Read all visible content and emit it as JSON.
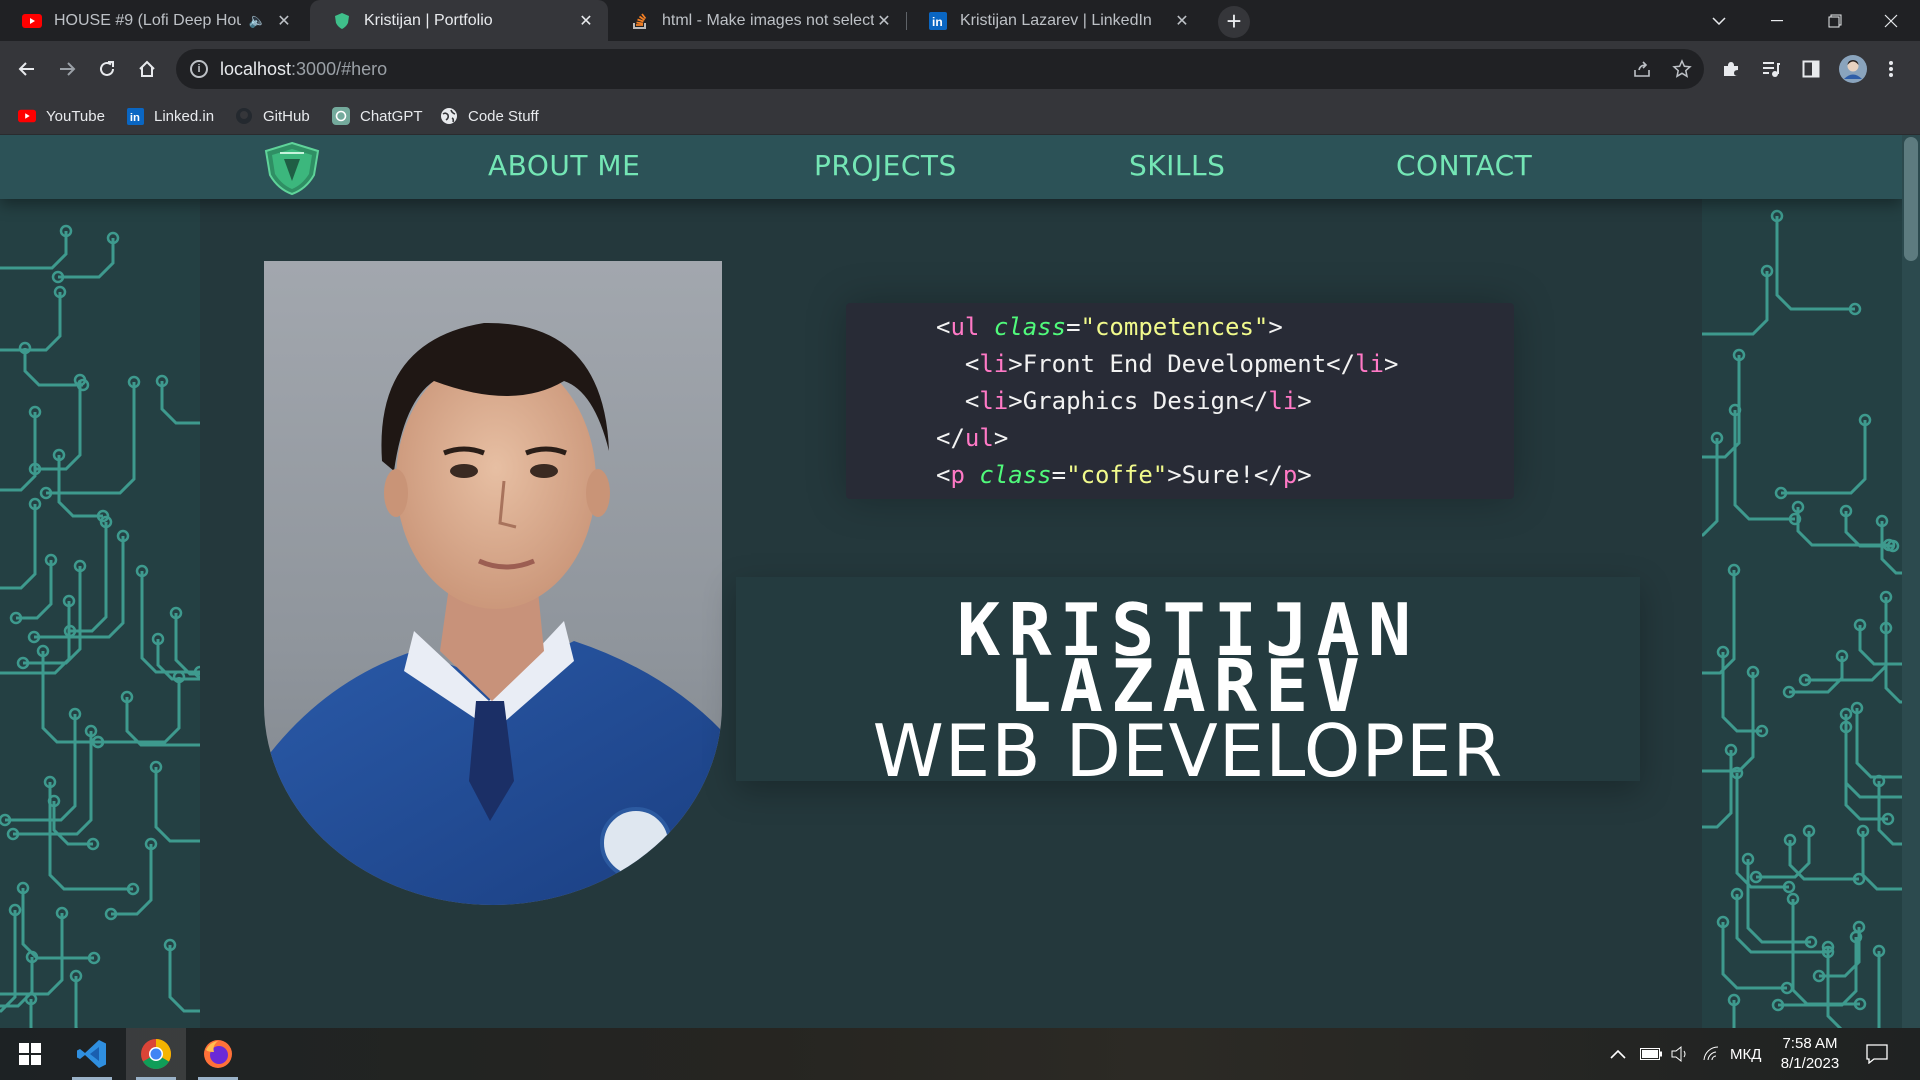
{
  "browser": {
    "tabs": [
      {
        "title": "HOUSE #9 (Lofi Deep House)",
        "icon": "youtube-icon",
        "audio": true
      },
      {
        "title": "Kristijan | Portfolio",
        "icon": "portfolio-shield-icon",
        "active": true
      },
      {
        "title": "html - Make images not selectable",
        "icon": "stackoverflow-icon"
      },
      {
        "title": "Kristijan Lazarev | LinkedIn",
        "icon": "linkedin-icon"
      }
    ],
    "address": {
      "host": "localhost",
      "rest": ":3000/#hero"
    },
    "bookmarks": [
      {
        "label": "YouTube",
        "icon": "youtube-icon"
      },
      {
        "label": "Linked.in",
        "icon": "linkedin-icon"
      },
      {
        "label": "GitHub",
        "icon": "github-icon"
      },
      {
        "label": "ChatGPT",
        "icon": "chatgpt-icon"
      },
      {
        "label": "Code Stuff",
        "icon": "globe-icon"
      }
    ]
  },
  "site": {
    "nav": [
      {
        "label": "ABOUT ME"
      },
      {
        "label": "PROJECTS"
      },
      {
        "label": "SKILLS"
      },
      {
        "label": "CONTACT"
      }
    ],
    "code": {
      "ul_class": "competences",
      "items": [
        "Front End Development",
        "Graphics Design"
      ],
      "p_class": "coffe",
      "p_text": "Sure!"
    },
    "name_line1": "KRISTIJAN",
    "name_line2": "LAZAREV",
    "role": "WEB DEVELOPER"
  },
  "taskbar": {
    "apps": [
      "windows-start-icon",
      "vscode-icon",
      "chrome-icon",
      "firefox-icon"
    ],
    "language": "МКД",
    "time": "7:58 AM",
    "date": "8/1/2023"
  },
  "colors": {
    "nav_text": "#74e6b5",
    "page_bg": "#244043",
    "content_bg": "#24383c",
    "circuit": "#3e9a8e"
  }
}
